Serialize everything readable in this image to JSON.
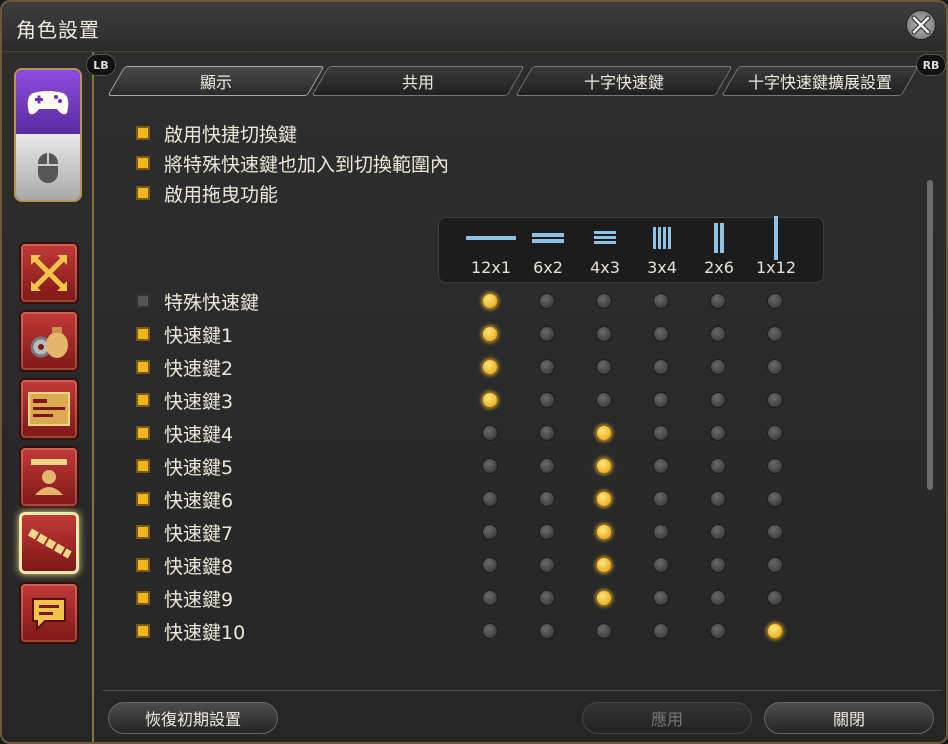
{
  "window": {
    "title": "角色設置"
  },
  "tabs": {
    "lb": "LB",
    "rb": "RB",
    "items": [
      {
        "label": "顯示",
        "active": true
      },
      {
        "label": "共用",
        "active": false
      },
      {
        "label": "十字快速鍵",
        "active": false
      },
      {
        "label": "十字快速鍵擴展設置",
        "active": false
      }
    ]
  },
  "options": [
    {
      "label": "啟用快捷切換鍵",
      "checked": true
    },
    {
      "label": "將特殊快速鍵也加入到切換範圍內",
      "checked": true
    },
    {
      "label": "啟用拖曳功能",
      "checked": true
    }
  ],
  "layouts": [
    "12x1",
    "6x2",
    "4x3",
    "3x4",
    "2x6",
    "1x12"
  ],
  "hotbars": [
    {
      "label": "特殊快速鍵",
      "checked": false,
      "selected": 0
    },
    {
      "label": "快速鍵1",
      "checked": true,
      "selected": 0
    },
    {
      "label": "快速鍵2",
      "checked": true,
      "selected": 0
    },
    {
      "label": "快速鍵3",
      "checked": true,
      "selected": 0
    },
    {
      "label": "快速鍵4",
      "checked": true,
      "selected": 2
    },
    {
      "label": "快速鍵5",
      "checked": true,
      "selected": 2
    },
    {
      "label": "快速鍵6",
      "checked": true,
      "selected": 2
    },
    {
      "label": "快速鍵7",
      "checked": true,
      "selected": 2
    },
    {
      "label": "快速鍵8",
      "checked": true,
      "selected": 2
    },
    {
      "label": "快速鍵9",
      "checked": true,
      "selected": 2
    },
    {
      "label": "快速鍵10",
      "checked": true,
      "selected": 5
    }
  ],
  "buttons": {
    "reset": "恢復初期設置",
    "apply": "應用",
    "close": "關閉"
  },
  "colors": {
    "accent": "#f2b51e",
    "frame": "#8a7240",
    "category_red": "#c23a3a",
    "mode_purple": "#8d4ee0"
  },
  "icons": {
    "mode": [
      "gamepad-icon",
      "mouse-icon"
    ],
    "categories": [
      "move-arrows-icon",
      "gear-bag-icon",
      "id-card-icon",
      "character-icon",
      "hotbar-icon",
      "chat-icon"
    ]
  }
}
